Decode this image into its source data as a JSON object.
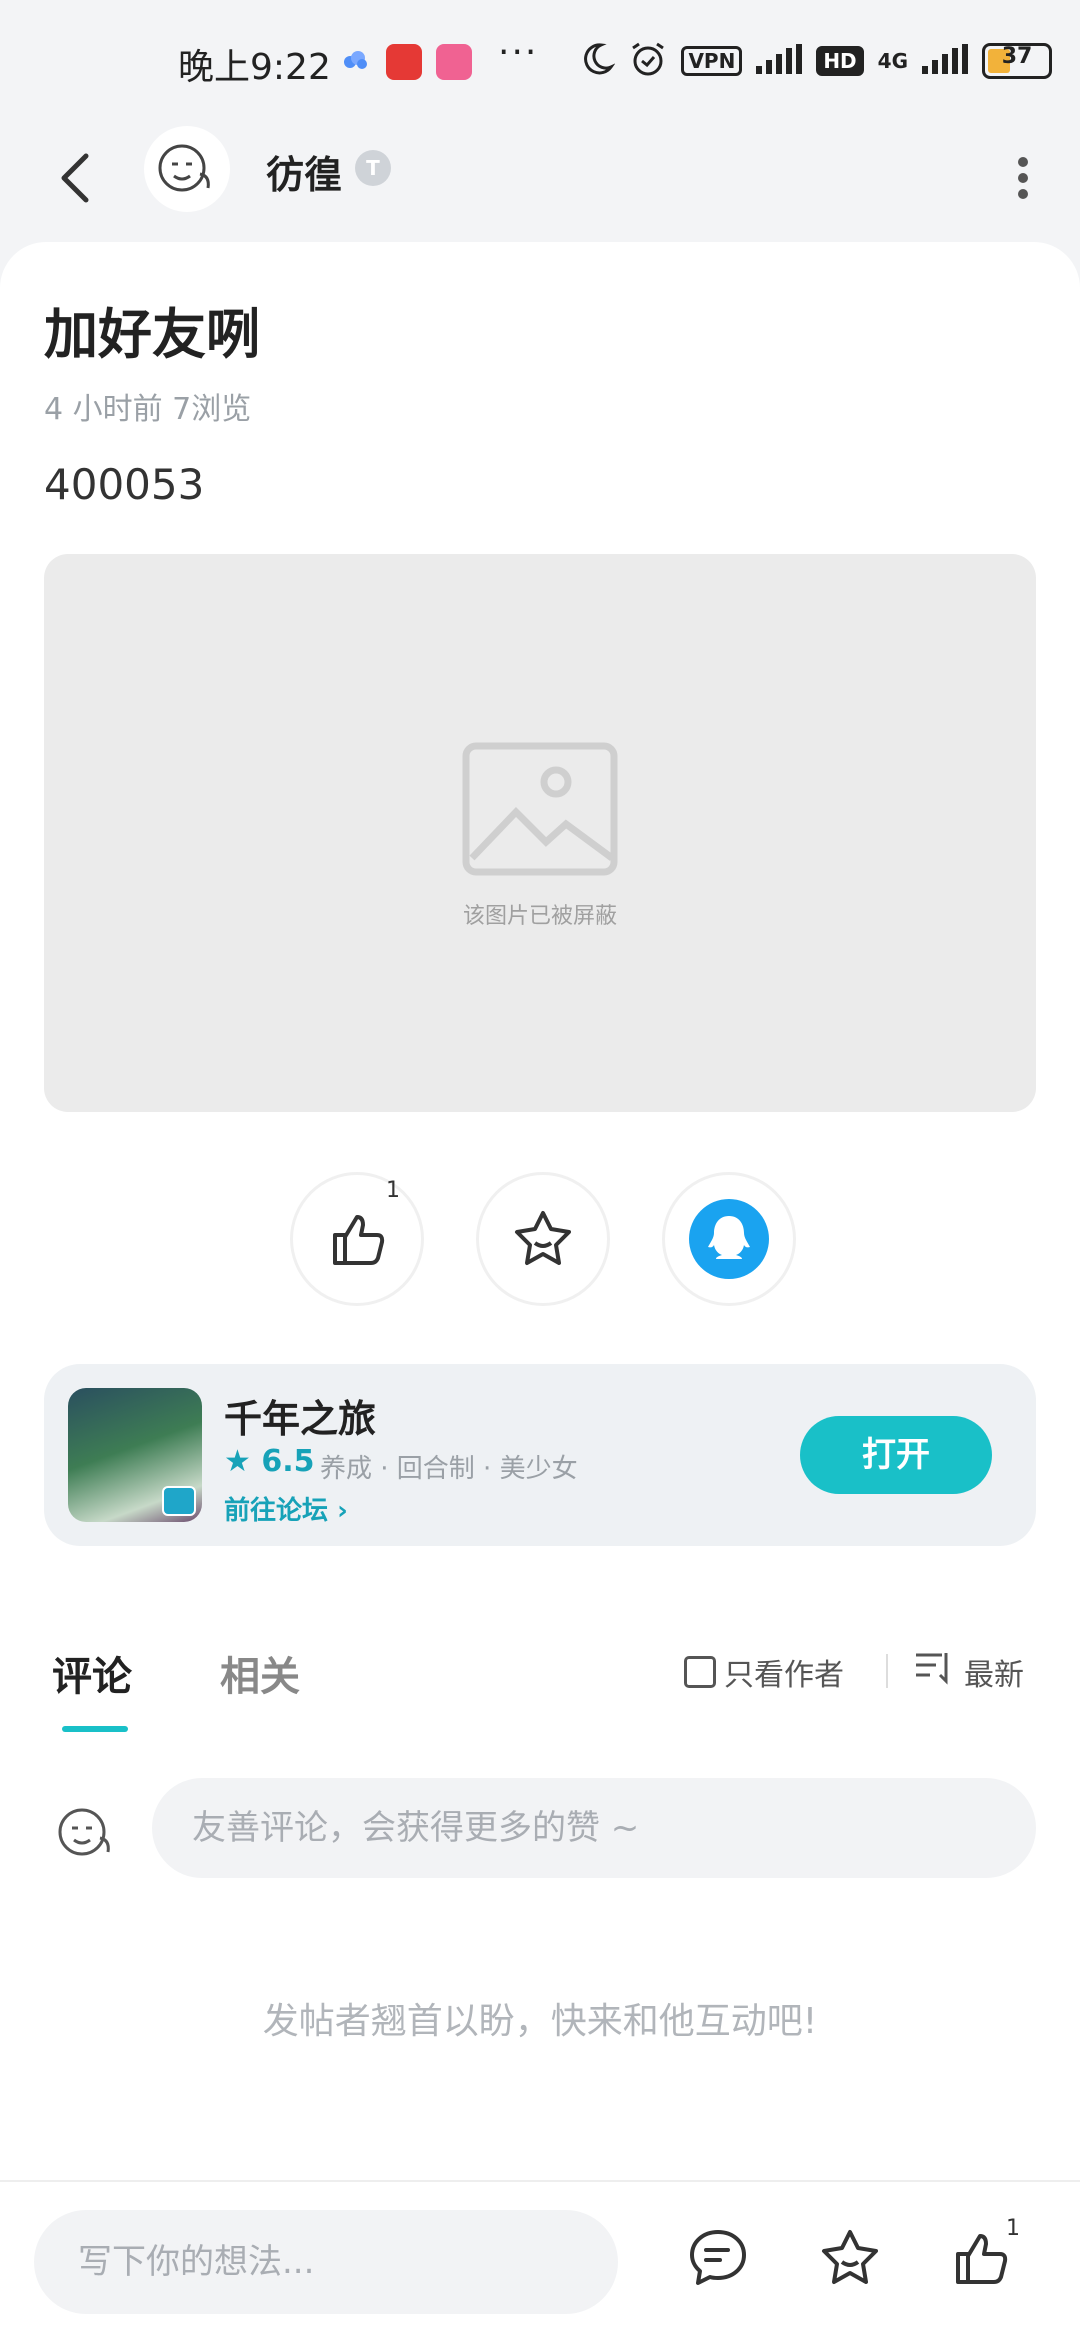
{
  "status_bar": {
    "time": "晚上9:22",
    "dots": "···",
    "vpn": "VPN",
    "hd": "HD",
    "network": "4G",
    "battery": "37",
    "app_colors": [
      "#e53935",
      "#f06292"
    ]
  },
  "header": {
    "author_name": "彷徨",
    "level_badge": "T"
  },
  "post": {
    "title": "加好友咧",
    "meta": "4 小时前   7浏览",
    "body": "400053",
    "blocked_image_text": "该图片已被屏蔽"
  },
  "actions": {
    "like_count": "1"
  },
  "game": {
    "name": "千年之旅",
    "rating": "6.5",
    "tags": "养成 · 回合制 · 美少女",
    "forum_link": "前往论坛",
    "open_label": "打开"
  },
  "comments": {
    "tab_comments": "评论",
    "tab_related": "相关",
    "only_author": "只看作者",
    "sort": "最新",
    "input_placeholder": "友善评论，会获得更多的赞 ~",
    "empty_message": "发帖者翘首以盼，快来和他互动吧!"
  },
  "bottom_bar": {
    "input_placeholder": "写下你的想法...",
    "like_count": "1"
  },
  "colors": {
    "accent": "#19c0c8",
    "qq_blue": "#1aa3f0"
  }
}
